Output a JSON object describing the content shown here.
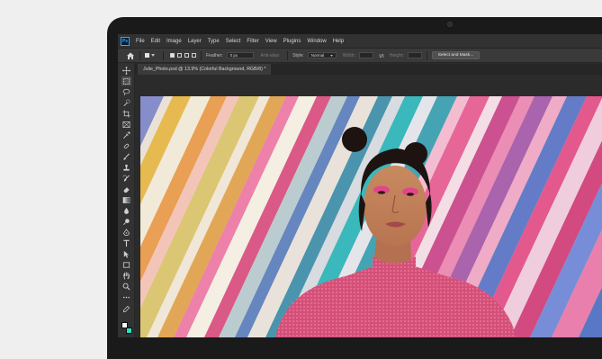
{
  "menu": {
    "logo": "Ps",
    "items": [
      "File",
      "Edit",
      "Image",
      "Layer",
      "Type",
      "Select",
      "Filter",
      "View",
      "Plugins",
      "Window",
      "Help"
    ]
  },
  "options": {
    "feather_label": "Feather:",
    "feather_value": "0 px",
    "anti_alias_label": "Anti-alias",
    "style_label": "Style:",
    "style_value": "Normal",
    "width_label": "Width:",
    "height_label": "Height:",
    "select_and_mask": "Select and Mask..."
  },
  "document": {
    "tab_title": "Julie_Photo.psd @ 13.9% (Colorful Background, RGB/8) *"
  },
  "tools": [
    "move-icon",
    "rectangular-marquee-icon",
    "lasso-icon",
    "quick-selection-icon",
    "crop-icon",
    "frame-icon",
    "eyedropper-icon",
    "spot-healing-icon",
    "brush-icon",
    "clone-stamp-icon",
    "history-brush-icon",
    "eraser-icon",
    "gradient-icon",
    "blur-icon",
    "dodge-icon",
    "pen-icon",
    "type-icon",
    "path-selection-icon",
    "rectangle-icon",
    "hand-icon",
    "zoom-icon",
    "more-tools-icon"
  ],
  "colors": {
    "foreground": "#f5f5f5",
    "background": "#2be0c0",
    "accent": "#31a8ff"
  }
}
